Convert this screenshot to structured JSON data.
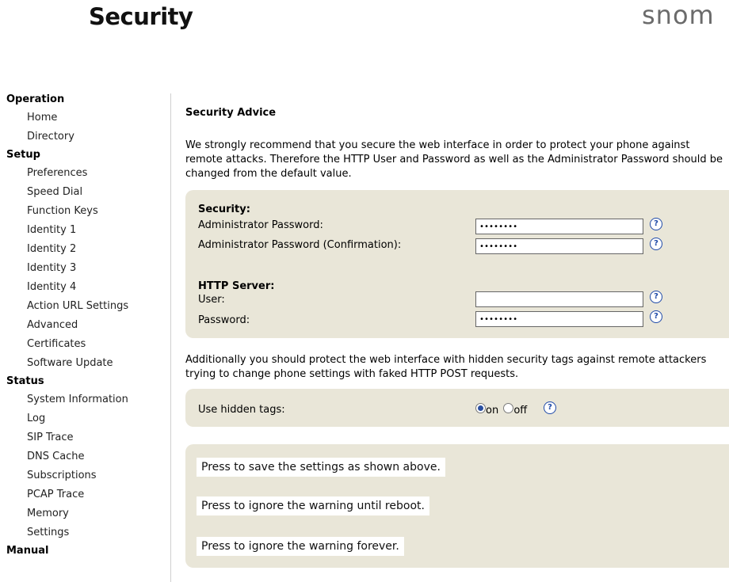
{
  "header": {
    "title": "Security",
    "logo_text": "snom"
  },
  "sidebar": {
    "sections": [
      {
        "label": "Operation",
        "items": [
          "Home",
          "Directory"
        ]
      },
      {
        "label": "Setup",
        "items": [
          "Preferences",
          "Speed Dial",
          "Function Keys",
          "Identity 1",
          "Identity 2",
          "Identity 3",
          "Identity 4",
          "Action URL Settings",
          "Advanced",
          "Certificates",
          "Software Update"
        ]
      },
      {
        "label": "Status",
        "items": [
          "System Information",
          "Log",
          "SIP Trace",
          "DNS Cache",
          "Subscriptions",
          "PCAP Trace",
          "Memory",
          "Settings"
        ]
      },
      {
        "label": "Manual",
        "items": []
      }
    ]
  },
  "main": {
    "advice_title": "Security Advice",
    "advice_text": "We strongly recommend that you secure the web interface in order to protect your phone against remote attacks. Therefore the HTTP User and Password as well as the Administrator Password should be changed from the default value.",
    "security": {
      "title": "Security:",
      "admin_password_label": "Administrator Password:",
      "admin_password_value": "••••••••",
      "admin_password_confirm_label": "Administrator Password (Confirmation):",
      "admin_password_confirm_value": "••••••••"
    },
    "http": {
      "title": "HTTP Server:",
      "user_label": "User:",
      "user_value": "",
      "password_label": "Password:",
      "password_value": "••••••••"
    },
    "help_glyph": "?",
    "additional_text": "Additionally you should protect the web interface with hidden security tags against remote attackers trying to change phone settings with faked HTTP POST requests.",
    "hidden_tags": {
      "label": "Use hidden tags:",
      "option_on": "on",
      "option_off": "off",
      "selected": "on"
    },
    "actions": {
      "save": "Press to save the settings as shown above.",
      "ignore_reboot": "Press to ignore the warning until reboot.",
      "ignore_forever": "Press to ignore the warning forever."
    }
  },
  "colors": {
    "panel_bg": "#e9e6d8",
    "help_accent": "#1f4aa8",
    "logo": "#6b6b6b"
  }
}
